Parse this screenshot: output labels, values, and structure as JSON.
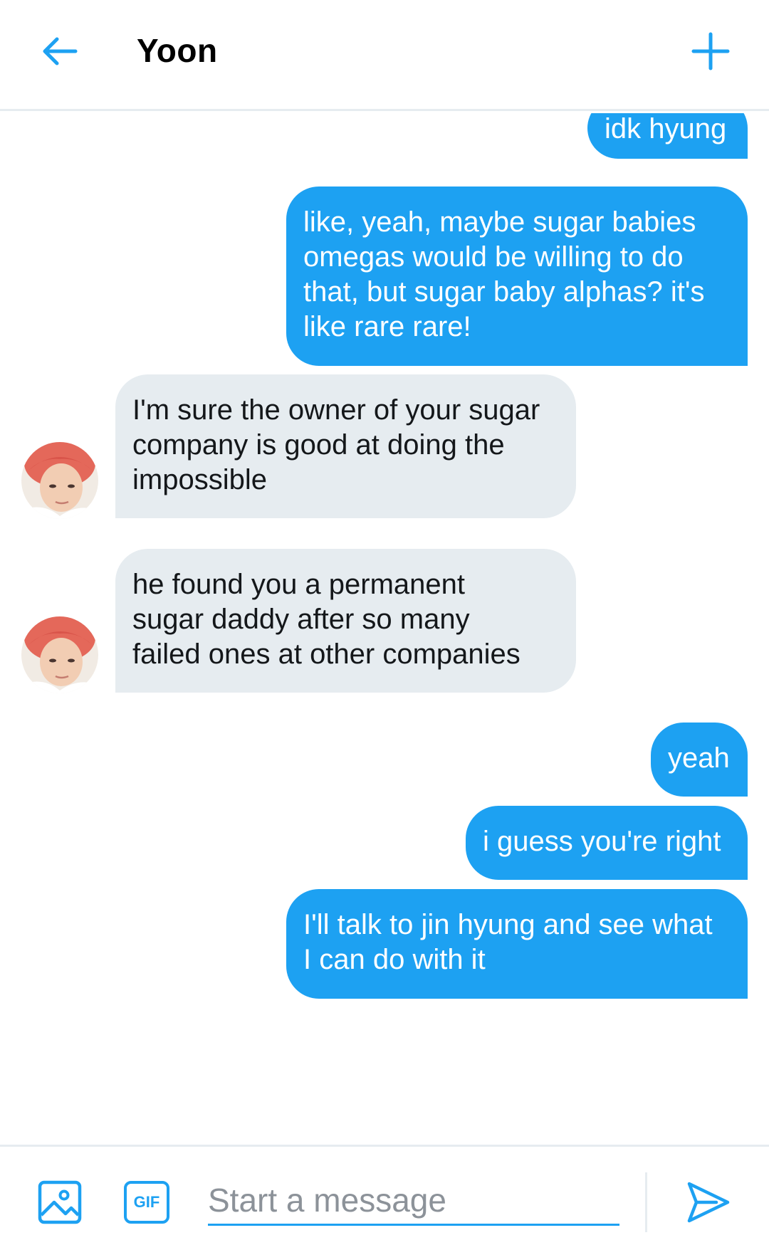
{
  "header": {
    "title": "Yoon"
  },
  "messages": [
    {
      "side": "out",
      "text": "idk hyung"
    },
    {
      "side": "out",
      "text": "like, yeah, maybe sugar babies\nomegas would be willing to do\nthat, but sugar baby alphas? it's\nlike rare rare!"
    },
    {
      "side": "in",
      "text": "I'm sure the owner of your sugar\ncompany is good at doing the\nimpossible"
    },
    {
      "side": "in",
      "text": "he found you a permanent\nsugar daddy after so many\nfailed ones at other companies"
    },
    {
      "side": "out",
      "text": "yeah"
    },
    {
      "side": "out",
      "text": "i guess you're right"
    },
    {
      "side": "out",
      "text": "I'll talk to jin hyung and see what\nI can do with it"
    }
  ],
  "composer": {
    "gif_label": "GIF",
    "placeholder": "Start a message"
  },
  "icons": {
    "back": "arrow-left-icon",
    "add": "plus-icon",
    "image": "image-icon",
    "gif": "gif-icon",
    "send": "send-icon"
  },
  "colors": {
    "accent": "#1da1f2",
    "incoming_bubble": "#e6ecf0",
    "divider": "#e6ecf0"
  }
}
